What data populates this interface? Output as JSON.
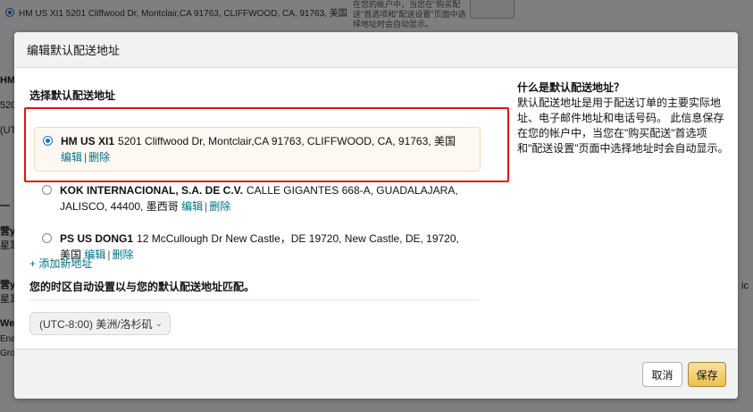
{
  "background": {
    "top_row": "HM US XI1 5201 Cliffwood Dr, Montclair,CA 91763, CLIFFWOOD, CA, 91763, 美国",
    "top_note": "在您的帐户中，当您在\"购买配送\"首选项和\"配送设置\"页面中选择地址时会自动显示。",
    "left_labels": [
      "HM",
      "520",
      "(UT",
      "一",
      "营y",
      "星耳",
      "营y",
      "星耳",
      "We",
      "Ena",
      "Gro"
    ],
    "right_label": "ic"
  },
  "modal": {
    "title": "编辑默认配送地址",
    "section_title": "选择默认配送地址",
    "addresses": [
      {
        "name": "HM US XI1",
        "line": "5201 Cliffwood Dr, Montclair,CA 91763, CLIFFWOOD, CA, 91763, 美国",
        "edit": "编辑",
        "delete": "删除",
        "selected": true
      },
      {
        "name": "KOK INTERNACIONAL, S.A. DE C.V.",
        "line": "CALLE GIGANTES 668-A, GUADALAJARA, JALISCO, 44400, 墨西哥",
        "edit": "编辑",
        "delete": "删除",
        "selected": false
      },
      {
        "name": "PS US DONG1",
        "line": "12 McCullough Dr New Castle，DE 19720, New Castle, DE, 19720, 美国",
        "edit": "编辑",
        "delete": "删除",
        "selected": false
      }
    ],
    "add_address": "+ 添加新地址",
    "timezone_note": "您的时区自动设置以与您的默认配送地址匹配。",
    "timezone_value": "(UTC-8:00) 美洲/洛杉矶",
    "help_title": "什么是默认配送地址？",
    "help_body": "默认配送地址是用于配送订单的主要实际地址、电子邮件地址和电话号码。 此信息保存在您的帐户中，当您在\"购买配送\"首选项和\"配送设置\"页面中选择地址时会自动显示。",
    "cancel_label": "取消",
    "save_label": "保存"
  },
  "colors": {
    "link": "#007185",
    "highlight_border": "#e01414",
    "selected_bg": "#fef8f2",
    "save_button": "#f0c14b"
  }
}
